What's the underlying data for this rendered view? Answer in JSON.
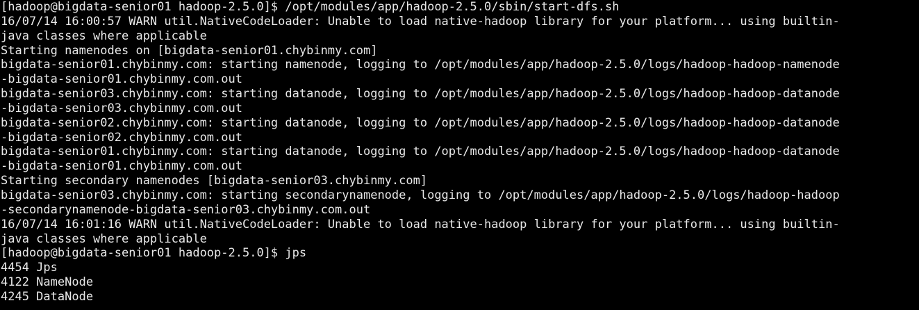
{
  "terminal": {
    "lines": [
      "[hadoop@bigdata-senior01 hadoop-2.5.0]$ /opt/modules/app/hadoop-2.5.0/sbin/start-dfs.sh",
      "16/07/14 16:00:57 WARN util.NativeCodeLoader: Unable to load native-hadoop library for your platform... using builtin-",
      "java classes where applicable",
      "Starting namenodes on [bigdata-senior01.chybinmy.com]",
      "bigdata-senior01.chybinmy.com: starting namenode, logging to /opt/modules/app/hadoop-2.5.0/logs/hadoop-hadoop-namenode",
      "-bigdata-senior01.chybinmy.com.out",
      "bigdata-senior03.chybinmy.com: starting datanode, logging to /opt/modules/app/hadoop-2.5.0/logs/hadoop-hadoop-datanode",
      "-bigdata-senior03.chybinmy.com.out",
      "bigdata-senior02.chybinmy.com: starting datanode, logging to /opt/modules/app/hadoop-2.5.0/logs/hadoop-hadoop-datanode",
      "-bigdata-senior02.chybinmy.com.out",
      "bigdata-senior01.chybinmy.com: starting datanode, logging to /opt/modules/app/hadoop-2.5.0/logs/hadoop-hadoop-datanode",
      "-bigdata-senior01.chybinmy.com.out",
      "Starting secondary namenodes [bigdata-senior03.chybinmy.com]",
      "bigdata-senior03.chybinmy.com: starting secondarynamenode, logging to /opt/modules/app/hadoop-2.5.0/logs/hadoop-hadoop",
      "-secondarynamenode-bigdata-senior03.chybinmy.com.out",
      "16/07/14 16:01:16 WARN util.NativeCodeLoader: Unable to load native-hadoop library for your platform... using builtin-",
      "java classes where applicable",
      "[hadoop@bigdata-senior01 hadoop-2.5.0]$ jps",
      "4454 Jps",
      "4122 NameNode",
      "4245 DataNode"
    ],
    "colors": {
      "background": "#000000",
      "foreground": "#e8e8e8"
    }
  }
}
